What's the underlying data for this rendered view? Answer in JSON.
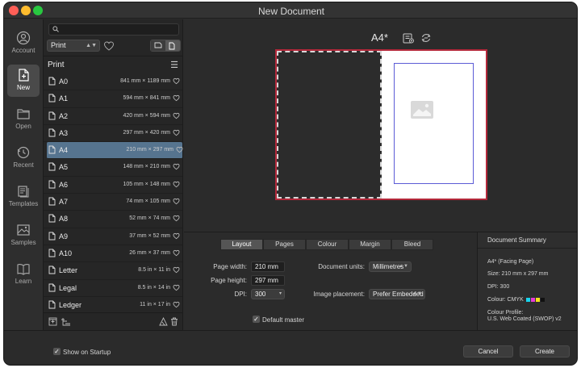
{
  "window": {
    "title": "New Document"
  },
  "rail": {
    "items": [
      {
        "label": "Account",
        "icon": "account-icon"
      },
      {
        "label": "New",
        "icon": "new-document-icon"
      },
      {
        "label": "Open",
        "icon": "folder-icon"
      },
      {
        "label": "Recent",
        "icon": "recent-clock-icon"
      },
      {
        "label": "Templates",
        "icon": "templates-icon"
      },
      {
        "label": "Samples",
        "icon": "samples-image-icon"
      },
      {
        "label": "Learn",
        "icon": "learn-book-icon"
      }
    ]
  },
  "panel": {
    "search_placeholder": "",
    "category": "Print",
    "list_title": "Print",
    "selected": "A4",
    "items": [
      {
        "name": "A0",
        "dims": "841 mm × 1189 mm"
      },
      {
        "name": "A1",
        "dims": "594 mm × 841 mm"
      },
      {
        "name": "A2",
        "dims": "420 mm × 594 mm"
      },
      {
        "name": "A3",
        "dims": "297 mm × 420 mm"
      },
      {
        "name": "A4",
        "dims": "210 mm × 297 mm"
      },
      {
        "name": "A5",
        "dims": "148 mm × 210 mm"
      },
      {
        "name": "A6",
        "dims": "105 mm × 148 mm"
      },
      {
        "name": "A7",
        "dims": "74 mm × 105 mm"
      },
      {
        "name": "A8",
        "dims": "52 mm × 74 mm"
      },
      {
        "name": "A9",
        "dims": "37 mm × 52 mm"
      },
      {
        "name": "A10",
        "dims": "26 mm × 37 mm"
      },
      {
        "name": "Letter",
        "dims": "8.5 in × 11 in"
      },
      {
        "name": "Legal",
        "dims": "8.5 in × 14 in"
      },
      {
        "name": "Ledger",
        "dims": "11 in × 17 in"
      }
    ]
  },
  "preview": {
    "name": "A4*"
  },
  "tabs": [
    {
      "label": "Layout",
      "active": true
    },
    {
      "label": "Pages",
      "active": false
    },
    {
      "label": "Colour",
      "active": false
    },
    {
      "label": "Margin",
      "active": false
    },
    {
      "label": "Bleed",
      "active": false
    }
  ],
  "layout": {
    "page_width_label": "Page width:",
    "page_width": "210 mm",
    "page_height_label": "Page height:",
    "page_height": "297 mm",
    "dpi_label": "DPI:",
    "dpi": "300",
    "units_label": "Document units:",
    "units": "Millimetres",
    "placement_label": "Image placement:",
    "placement": "Prefer Embedded",
    "default_master_label": "Default master",
    "default_master_checked": true
  },
  "summary": {
    "title": "Document Summary",
    "name": "A4* (Facing Page)",
    "size": "Size: 210 mm x 297 mm",
    "dpi": "DPI:  300",
    "colour": "Colour: CMYK",
    "colour_swatches": [
      "#19d3ee",
      "#e63cd6",
      "#f2e11b",
      "#111111"
    ],
    "profile_label": "Colour Profile:",
    "profile": "U.S. Web Coated (SWOP) v2"
  },
  "footer": {
    "show_on_startup": "Show on Startup",
    "show_on_startup_checked": true,
    "cancel": "Cancel",
    "create": "Create"
  },
  "colors": {
    "selection": "#56748f",
    "spread_border": "#b3283a",
    "margin_guide": "#5b5bd6"
  }
}
